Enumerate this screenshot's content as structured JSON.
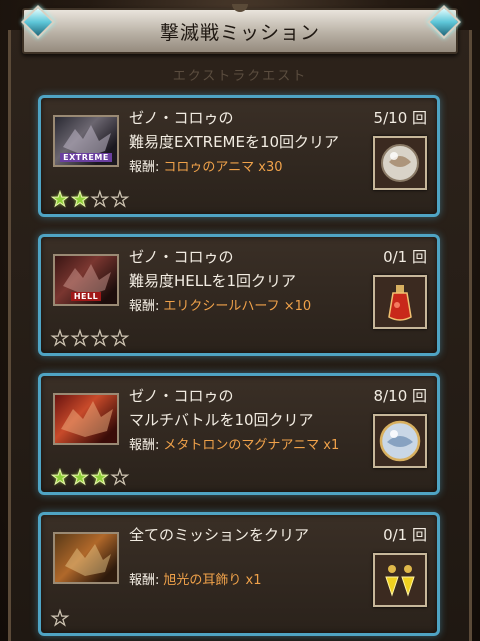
{
  "header": {
    "title": "撃滅戦ミッション"
  },
  "background_label": "エクストラクエスト",
  "missions": [
    {
      "line1": "ゼノ・コロゥの",
      "line2": "難易度EXTREMEを10回クリア",
      "reward_label": "報酬:",
      "reward_value": "コロゥのアニマ x30",
      "progress": "5/10 回",
      "thumb_label": "EXTREME",
      "item_icon": "anima-orb-icon",
      "stars_filled": 2,
      "stars_total": 4
    },
    {
      "line1": "ゼノ・コロゥの",
      "line2": "難易度HELLを1回クリア",
      "reward_label": "報酬:",
      "reward_value": "エリクシールハーフ ×10",
      "progress": "0/1 回",
      "thumb_label": "HELL",
      "item_icon": "elixir-potion-icon",
      "stars_filled": 0,
      "stars_total": 4
    },
    {
      "line1": "ゼノ・コロゥの",
      "line2": "マルチバトルを10回クリア",
      "reward_label": "報酬:",
      "reward_value": "メタトロンのマグナアニマ x1",
      "progress": "8/10 回",
      "thumb_label": "",
      "item_icon": "magna-anima-orb-icon",
      "stars_filled": 3,
      "stars_total": 4
    },
    {
      "line1": "全てのミッションをクリア",
      "line2": "",
      "reward_label": "報酬:",
      "reward_value": "旭光の耳飾り x1",
      "progress": "0/1 回",
      "thumb_label": "",
      "item_icon": "earring-icon",
      "stars_filled": 0,
      "stars_total": 1
    }
  ],
  "colors": {
    "card_border": "#4fa4c4",
    "reward_value": "#f0a24a",
    "star_filled": "#8fcf3a"
  }
}
